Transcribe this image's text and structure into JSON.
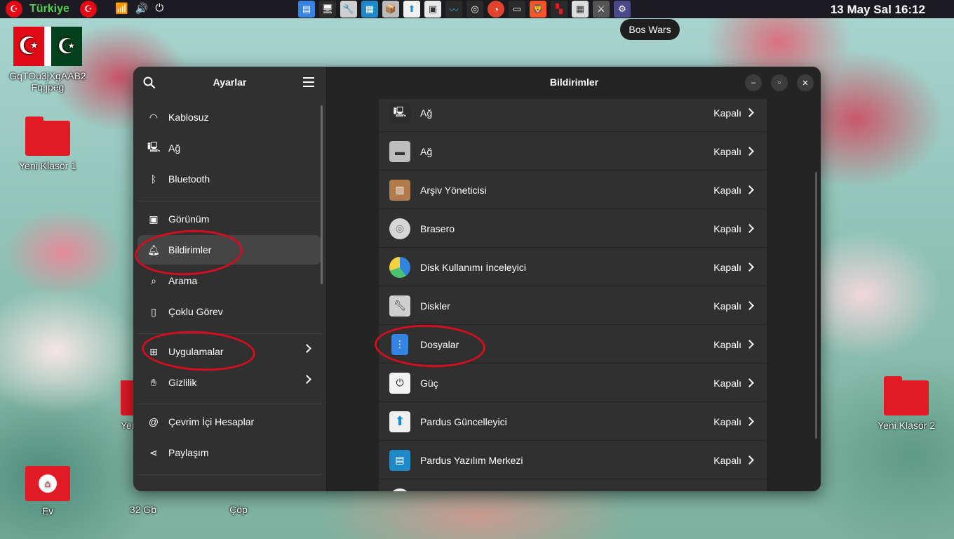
{
  "topbar": {
    "title": "Türkiye",
    "clock": "13 May Sal  16:12",
    "tooltip": "Bos Wars"
  },
  "desktop": {
    "items": [
      {
        "label": "GqTOu3jXgAAB2\nFq.jpeg"
      },
      {
        "label": "Yeni Klasör 1"
      },
      {
        "label": "Yeni Klasör 2"
      },
      {
        "label": "Ev"
      },
      {
        "label": "32 Gb"
      },
      {
        "label": "Çöp"
      },
      {
        "label": "Yen"
      }
    ]
  },
  "settings": {
    "sidebar_title": "Ayarlar",
    "main_title": "Bildirimler",
    "sidebar_items": [
      {
        "label": "Kablosuz",
        "icon": "wifi-icon"
      },
      {
        "label": "Ağ",
        "icon": "network-icon"
      },
      {
        "label": "Bluetooth",
        "icon": "bluetooth-icon"
      },
      {
        "label": "Görünüm",
        "icon": "appearance-icon"
      },
      {
        "label": "Bildirimler",
        "icon": "bell-icon"
      },
      {
        "label": "Arama",
        "icon": "search-icon"
      },
      {
        "label": "Çoklu Görev",
        "icon": "multitask-icon"
      },
      {
        "label": "Uygulamalar",
        "icon": "apps-icon"
      },
      {
        "label": "Gizlilik",
        "icon": "hand-icon"
      },
      {
        "label": "Çevrim İçi Hesaplar",
        "icon": "at-icon"
      },
      {
        "label": "Paylaşım",
        "icon": "share-icon"
      }
    ],
    "apps": [
      {
        "name": "Ağ",
        "status": "Kapalı",
        "color": "#2c2c2c"
      },
      {
        "name": "Ağ",
        "status": "Kapalı",
        "color": "#bdbdbd"
      },
      {
        "name": "Arşiv Yöneticisi",
        "status": "Kapalı",
        "color": "#b07a4a"
      },
      {
        "name": "Brasero",
        "status": "Kapalı",
        "color": "#d6d6d6"
      },
      {
        "name": "Disk Kullanımı İnceleyici",
        "status": "Kapalı",
        "color": "#2e86de"
      },
      {
        "name": "Diskler",
        "status": "Kapalı",
        "color": "#cfcfcf"
      },
      {
        "name": "Dosyalar",
        "status": "Kapalı",
        "color": "#3584e4"
      },
      {
        "name": "Güç",
        "status": "Kapalı",
        "color": "#2c2c2c"
      },
      {
        "name": "Pardus Güncelleyici",
        "status": "Kapalı",
        "color": "#f0f0f0"
      },
      {
        "name": "Pardus Yazılım Merkezi",
        "status": "Kapalı",
        "color": "#1e88c8"
      }
    ]
  },
  "colors": {
    "accent_annotation": "#d40e1e",
    "window_bg": "#242424",
    "sidebar_bg": "#303030"
  }
}
